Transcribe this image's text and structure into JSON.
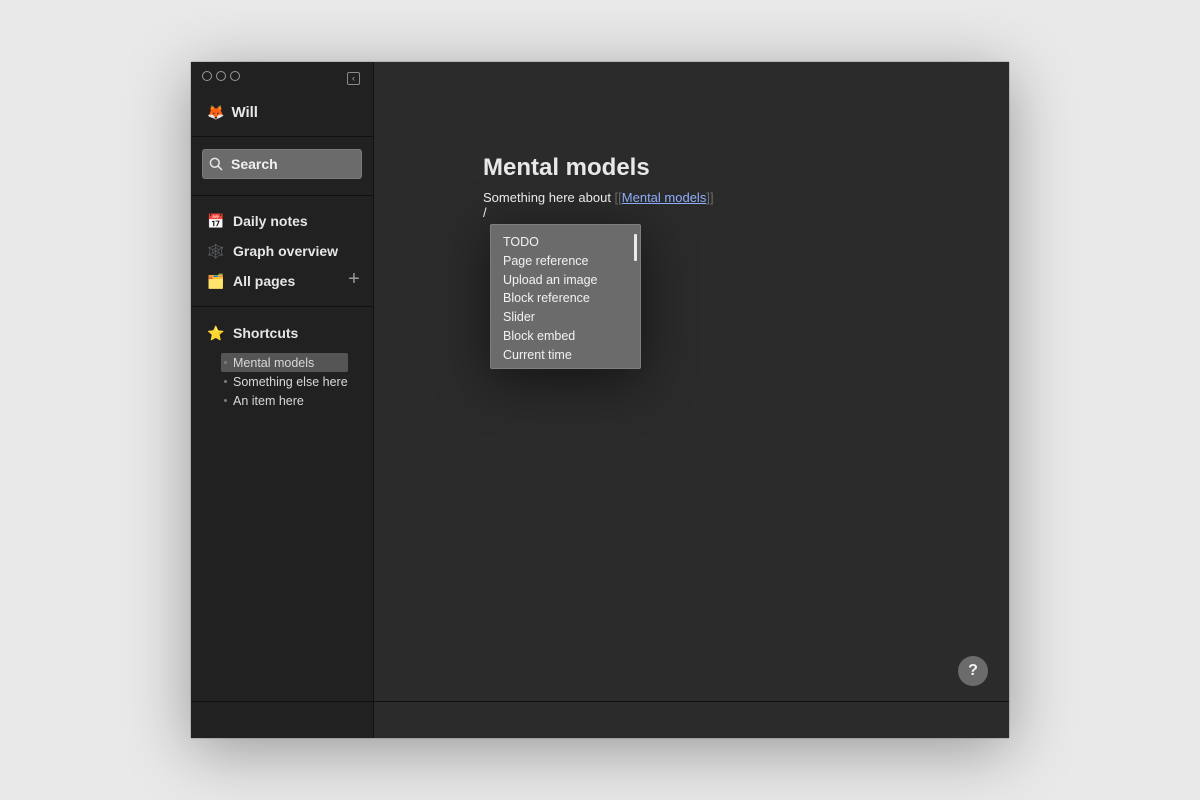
{
  "window": {
    "traffic_lights": [
      "close",
      "minimize",
      "zoom"
    ],
    "collapse_icon": "chevron-left-icon"
  },
  "sidebar": {
    "user": {
      "emoji": "🦊",
      "name": "Will"
    },
    "search": {
      "label": "Search",
      "icon": "search-icon"
    },
    "nav": [
      {
        "id": "daily-notes",
        "label": "Daily notes",
        "icon": "calendar-icon",
        "glyph": "📅"
      },
      {
        "id": "graph-overview",
        "label": "Graph overview",
        "icon": "graph-icon",
        "glyph": "🕸️"
      },
      {
        "id": "all-pages",
        "label": "All pages",
        "icon": "folder-icon",
        "glyph": "🗂️"
      }
    ],
    "add_symbol": "+",
    "shortcuts": {
      "label": "Shortcuts",
      "glyph": "⭐",
      "items": [
        "Mental models",
        "Something else here",
        "An item here"
      ]
    }
  },
  "main": {
    "page_title": "Mental models",
    "block_prefix": "Something here about ",
    "bracket_open": "[[",
    "reference": "Mental models",
    "bracket_close": "]]",
    "slash": "/",
    "slash_menu": [
      "TODO",
      "Page reference",
      "Upload an image",
      "Block reference",
      "Slider",
      "Block embed",
      "Current time"
    ],
    "help_label": "?"
  },
  "colors": {
    "window_bg": "#2b2b2b",
    "sidebar_bg": "#212121",
    "search_bg": "#6b6b6b",
    "menu_bg": "#6b6b6b",
    "link": "#8fb0ff"
  }
}
